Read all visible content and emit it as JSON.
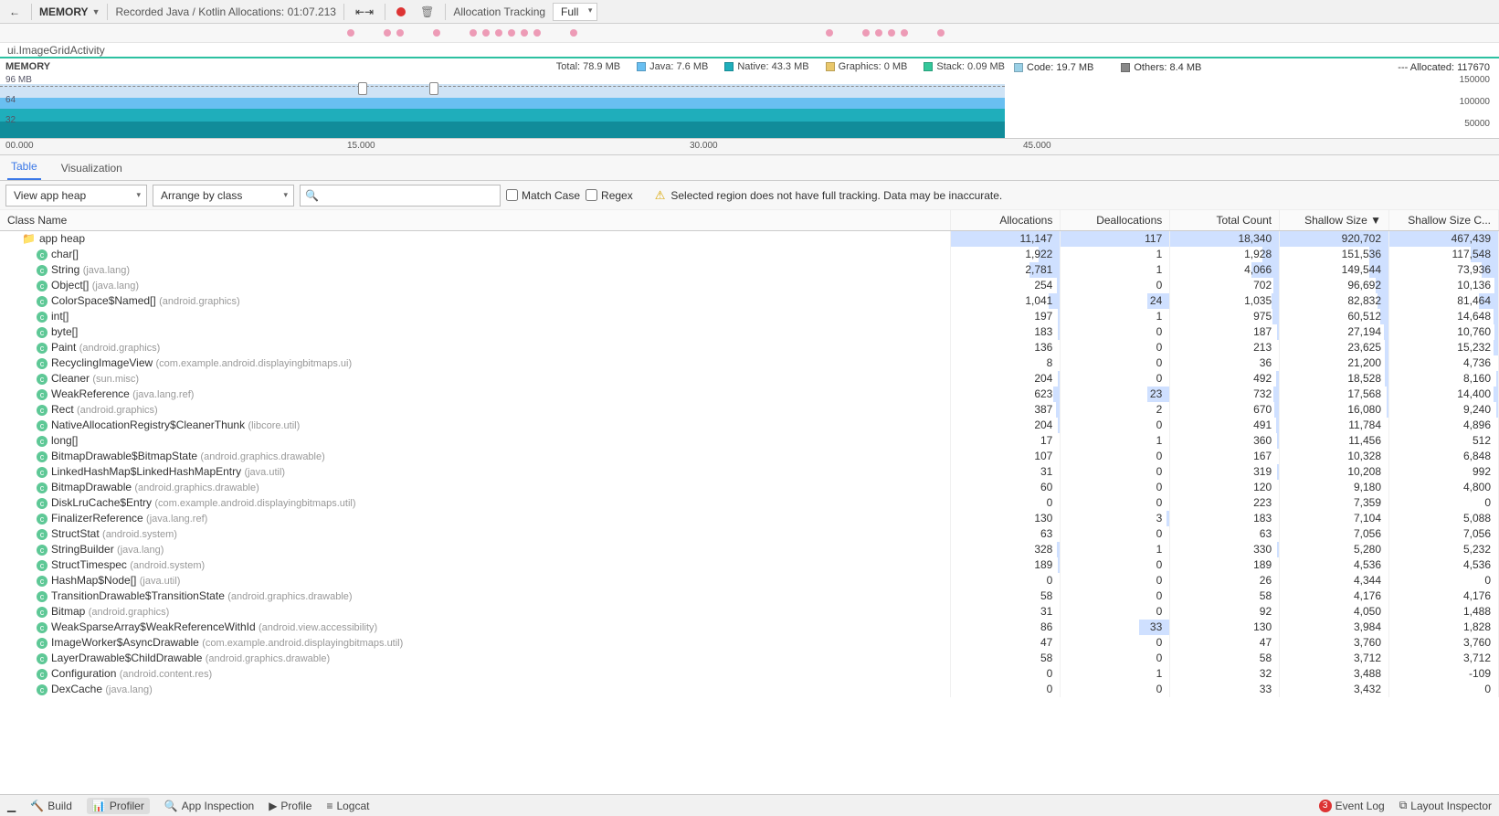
{
  "toolbar": {
    "memory_label": "MEMORY",
    "recording_label": "Recorded Java / Kotlin Allocations: 01:07.213",
    "alloc_tracking_label": "Allocation Tracking",
    "alloc_tracking_value": "Full"
  },
  "activity": "ui.ImageGridActivity",
  "memory": {
    "title": "MEMORY",
    "ylabel": "96 MB",
    "tick64": "64",
    "tick32": "32",
    "total": "Total: 78.9 MB",
    "java": "Java: 7.6 MB",
    "native": "Native: 43.3 MB",
    "graphics": "Graphics: 0 MB",
    "stack": "Stack: 0.09 MB",
    "code": "Code: 19.7 MB",
    "others": "Others: 8.4 MB",
    "allocated": "Allocated: 117670",
    "axis150": "150000",
    "axis100": "100000",
    "axis50": "50000"
  },
  "time_axis": {
    "t0": "00.000",
    "t15": "15.000",
    "t30": "30.000",
    "t45": "45.000"
  },
  "tabs": {
    "table": "Table",
    "viz": "Visualization"
  },
  "filter": {
    "heap": "View app heap",
    "arrange": "Arrange by class",
    "search_placeholder": "",
    "match_case": "Match Case",
    "regex": "Regex",
    "warn": "Selected region does not have full tracking. Data may be inaccurate."
  },
  "columns": {
    "c0": "Class Name",
    "c1": "Allocations",
    "c2": "Deallocations",
    "c3": "Total Count",
    "c4": "Shallow Size",
    "c5": "Shallow Size C..."
  },
  "app_heap_row": {
    "name": "app heap",
    "alloc": "11,147",
    "dealloc": "117",
    "total": "18,340",
    "shallow": "920,702",
    "shallowc": "467,439"
  },
  "rows": [
    {
      "name": "char[]",
      "pkg": "",
      "alloc": "1,922",
      "dealloc": "1",
      "total": "1,928",
      "shallow": "151,536",
      "shallowc": "117,548",
      "a_bar": 20,
      "t_bar": 15,
      "s_bar": 18,
      "sc_bar": 25
    },
    {
      "name": "String",
      "pkg": "(java.lang)",
      "alloc": "2,781",
      "dealloc": "1",
      "total": "4,066",
      "shallow": "149,544",
      "shallowc": "73,936",
      "a_bar": 28,
      "t_bar": 25,
      "s_bar": 18,
      "sc_bar": 15
    },
    {
      "name": "Object[]",
      "pkg": "(java.lang)",
      "alloc": "254",
      "dealloc": "0",
      "total": "702",
      "shallow": "96,692",
      "shallowc": "10,136",
      "a_bar": 3,
      "t_bar": 5,
      "s_bar": 12,
      "sc_bar": 3
    },
    {
      "name": "ColorSpace$Named[]",
      "pkg": "(android.graphics)",
      "alloc": "1,041",
      "dealloc": "24",
      "total": "1,035",
      "shallow": "82,832",
      "shallowc": "81,464",
      "a_bar": 10,
      "d_bar": 20,
      "t_bar": 7,
      "s_bar": 10,
      "sc_bar": 18
    },
    {
      "name": "int[]",
      "pkg": "",
      "alloc": "197",
      "dealloc": "1",
      "total": "975",
      "shallow": "60,512",
      "shallowc": "14,648",
      "a_bar": 2,
      "t_bar": 6,
      "s_bar": 8,
      "sc_bar": 4
    },
    {
      "name": "byte[]",
      "pkg": "",
      "alloc": "183",
      "dealloc": "0",
      "total": "187",
      "shallow": "27,194",
      "shallowc": "10,760",
      "a_bar": 2,
      "t_bar": 2,
      "s_bar": 4,
      "sc_bar": 3
    },
    {
      "name": "Paint",
      "pkg": "(android.graphics)",
      "alloc": "136",
      "dealloc": "0",
      "total": "213",
      "shallow": "23,625",
      "shallowc": "15,232",
      "s_bar": 3,
      "sc_bar": 4
    },
    {
      "name": "RecyclingImageView",
      "pkg": "(com.example.android.displayingbitmaps.ui)",
      "alloc": "8",
      "dealloc": "0",
      "total": "36",
      "shallow": "21,200",
      "shallowc": "4,736",
      "s_bar": 3
    },
    {
      "name": "Cleaner",
      "pkg": "(sun.misc)",
      "alloc": "204",
      "dealloc": "0",
      "total": "492",
      "shallow": "18,528",
      "shallowc": "8,160",
      "a_bar": 2,
      "t_bar": 3,
      "s_bar": 3,
      "sc_bar": 2
    },
    {
      "name": "WeakReference",
      "pkg": "(java.lang.ref)",
      "alloc": "623",
      "dealloc": "23",
      "total": "732",
      "shallow": "17,568",
      "shallowc": "14,400",
      "a_bar": 6,
      "d_bar": 20,
      "t_bar": 5,
      "s_bar": 2,
      "sc_bar": 4
    },
    {
      "name": "Rect",
      "pkg": "(android.graphics)",
      "alloc": "387",
      "dealloc": "2",
      "total": "670",
      "shallow": "16,080",
      "shallowc": "9,240",
      "a_bar": 4,
      "t_bar": 4,
      "s_bar": 2,
      "sc_bar": 2
    },
    {
      "name": "NativeAllocationRegistry$CleanerThunk",
      "pkg": "(libcore.util)",
      "alloc": "204",
      "dealloc": "0",
      "total": "491",
      "shallow": "11,784",
      "shallowc": "4,896",
      "a_bar": 2,
      "t_bar": 3
    },
    {
      "name": "long[]",
      "pkg": "",
      "alloc": "17",
      "dealloc": "1",
      "total": "360",
      "shallow": "11,456",
      "shallowc": "512",
      "t_bar": 2
    },
    {
      "name": "BitmapDrawable$BitmapState",
      "pkg": "(android.graphics.drawable)",
      "alloc": "107",
      "dealloc": "0",
      "total": "167",
      "shallow": "10,328",
      "shallowc": "6,848"
    },
    {
      "name": "LinkedHashMap$LinkedHashMapEntry",
      "pkg": "(java.util)",
      "alloc": "31",
      "dealloc": "0",
      "total": "319",
      "shallow": "10,208",
      "shallowc": "992",
      "t_bar": 2
    },
    {
      "name": "BitmapDrawable",
      "pkg": "(android.graphics.drawable)",
      "alloc": "60",
      "dealloc": "0",
      "total": "120",
      "shallow": "9,180",
      "shallowc": "4,800"
    },
    {
      "name": "DiskLruCache$Entry",
      "pkg": "(com.example.android.displayingbitmaps.util)",
      "alloc": "0",
      "dealloc": "0",
      "total": "223",
      "shallow": "7,359",
      "shallowc": "0"
    },
    {
      "name": "FinalizerReference",
      "pkg": "(java.lang.ref)",
      "alloc": "130",
      "dealloc": "3",
      "total": "183",
      "shallow": "7,104",
      "shallowc": "5,088",
      "d_bar": 3
    },
    {
      "name": "StructStat",
      "pkg": "(android.system)",
      "alloc": "63",
      "dealloc": "0",
      "total": "63",
      "shallow": "7,056",
      "shallowc": "7,056"
    },
    {
      "name": "StringBuilder",
      "pkg": "(java.lang)",
      "alloc": "328",
      "dealloc": "1",
      "total": "330",
      "shallow": "5,280",
      "shallowc": "5,232",
      "a_bar": 3,
      "t_bar": 2
    },
    {
      "name": "StructTimespec",
      "pkg": "(android.system)",
      "alloc": "189",
      "dealloc": "0",
      "total": "189",
      "shallow": "4,536",
      "shallowc": "4,536",
      "a_bar": 2
    },
    {
      "name": "HashMap$Node[]",
      "pkg": "(java.util)",
      "alloc": "0",
      "dealloc": "0",
      "total": "26",
      "shallow": "4,344",
      "shallowc": "0"
    },
    {
      "name": "TransitionDrawable$TransitionState",
      "pkg": "(android.graphics.drawable)",
      "alloc": "58",
      "dealloc": "0",
      "total": "58",
      "shallow": "4,176",
      "shallowc": "4,176"
    },
    {
      "name": "Bitmap",
      "pkg": "(android.graphics)",
      "alloc": "31",
      "dealloc": "0",
      "total": "92",
      "shallow": "4,050",
      "shallowc": "1,488"
    },
    {
      "name": "WeakSparseArray$WeakReferenceWithId",
      "pkg": "(android.view.accessibility)",
      "alloc": "86",
      "dealloc": "33",
      "total": "130",
      "shallow": "3,984",
      "shallowc": "1,828",
      "d_bar": 28
    },
    {
      "name": "ImageWorker$AsyncDrawable",
      "pkg": "(com.example.android.displayingbitmaps.util)",
      "alloc": "47",
      "dealloc": "0",
      "total": "47",
      "shallow": "3,760",
      "shallowc": "3,760"
    },
    {
      "name": "LayerDrawable$ChildDrawable",
      "pkg": "(android.graphics.drawable)",
      "alloc": "58",
      "dealloc": "0",
      "total": "58",
      "shallow": "3,712",
      "shallowc": "3,712"
    },
    {
      "name": "Configuration",
      "pkg": "(android.content.res)",
      "alloc": "0",
      "dealloc": "1",
      "total": "32",
      "shallow": "3,488",
      "shallowc": "-109"
    },
    {
      "name": "DexCache",
      "pkg": "(java.lang)",
      "alloc": "0",
      "dealloc": "0",
      "total": "33",
      "shallow": "3,432",
      "shallowc": "0"
    }
  ],
  "statusbar": {
    "build": "Build",
    "profiler": "Profiler",
    "app_insp": "App Inspection",
    "profile": "Profile",
    "logcat": "Logcat",
    "event_log": "Event Log",
    "event_count": "3",
    "layout_insp": "Layout Inspector"
  }
}
